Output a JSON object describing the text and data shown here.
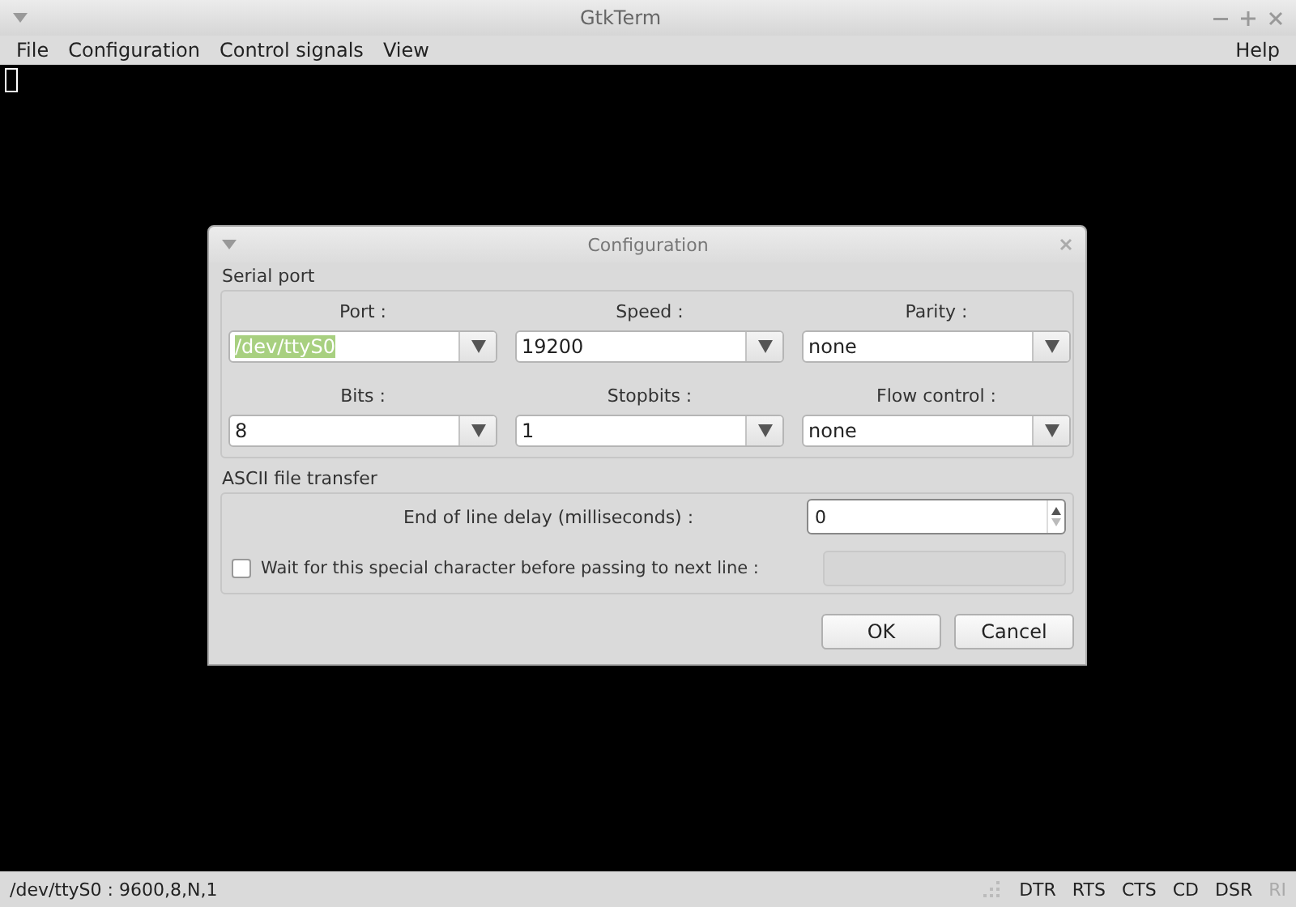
{
  "window": {
    "title": "GtkTerm"
  },
  "menu": {
    "left": [
      {
        "label": "File"
      },
      {
        "label": "Configuration"
      },
      {
        "label": "Control signals"
      },
      {
        "label": "View"
      }
    ],
    "right": [
      {
        "label": "Help"
      }
    ]
  },
  "dialog": {
    "title": "Configuration",
    "serial_port": {
      "title": "Serial port",
      "fields": [
        {
          "label": "Port :",
          "value": "/dev/ttyS0",
          "highlighted": true
        },
        {
          "label": "Speed :",
          "value": "19200",
          "highlighted": false
        },
        {
          "label": "Parity :",
          "value": "none",
          "highlighted": false
        },
        {
          "label": "Bits :",
          "value": "8",
          "highlighted": false
        },
        {
          "label": "Stopbits :",
          "value": "1",
          "highlighted": false
        },
        {
          "label": "Flow control :",
          "value": "none",
          "highlighted": false
        }
      ]
    },
    "ascii_transfer": {
      "title": "ASCII file transfer",
      "delay_label": "End of line delay (milliseconds) :",
      "delay_value": "0",
      "wait_label": "Wait for this special character before passing to next line :",
      "wait_checked": false,
      "special_character_disabled": true
    },
    "buttons": [
      {
        "label": "OK"
      },
      {
        "label": "Cancel"
      }
    ]
  },
  "status_bar": {
    "text": "/dev/ttyS0 : 9600,8,N,1",
    "signals": [
      {
        "label": "DTR",
        "on": true
      },
      {
        "label": "RTS",
        "on": true
      },
      {
        "label": "CTS",
        "on": true
      },
      {
        "label": "CD",
        "on": true
      },
      {
        "label": "DSR",
        "on": true
      },
      {
        "label": "RI",
        "on": false
      }
    ]
  }
}
